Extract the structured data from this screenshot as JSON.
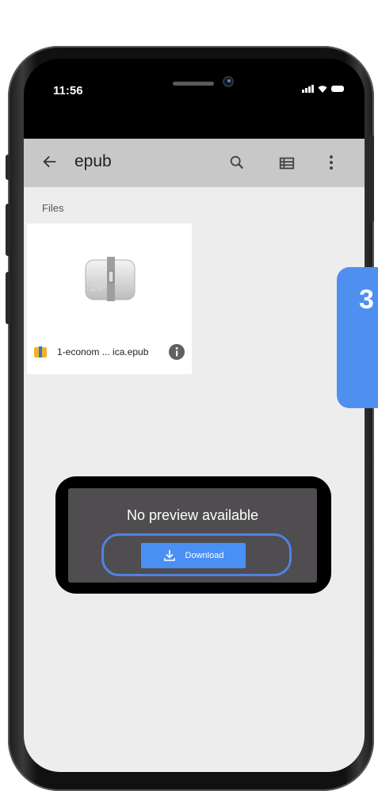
{
  "status_bar": {
    "time": "11:56",
    "signal_icon": "signal-icon",
    "wifi_icon": "wifi-icon",
    "battery_icon": "battery-icon"
  },
  "app_bar": {
    "title": "epub",
    "back_icon": "arrow-back-icon",
    "search_icon": "search-icon",
    "list_view_icon": "list-view-icon",
    "more_icon": "more-vert-icon"
  },
  "files_section": {
    "label": "Files",
    "items": [
      {
        "name": "1-econom ... ica.epub",
        "thumbnail_icon": "zip-archive-icon",
        "type_icon": "archive-file-icon",
        "info_icon": "info-icon"
      }
    ]
  },
  "preview_dialog": {
    "message": "No preview available",
    "download_label": "Download",
    "download_icon": "download-icon"
  },
  "step_tab": {
    "number": "3"
  },
  "colors": {
    "app_bar": "#c8c8c8",
    "content_bg": "#ededed",
    "dialog_bg": "#4f4d50",
    "download_button": "#4a8ff3",
    "highlight_outline": "#4f83e3",
    "step_tab": "#4f8ff0"
  }
}
